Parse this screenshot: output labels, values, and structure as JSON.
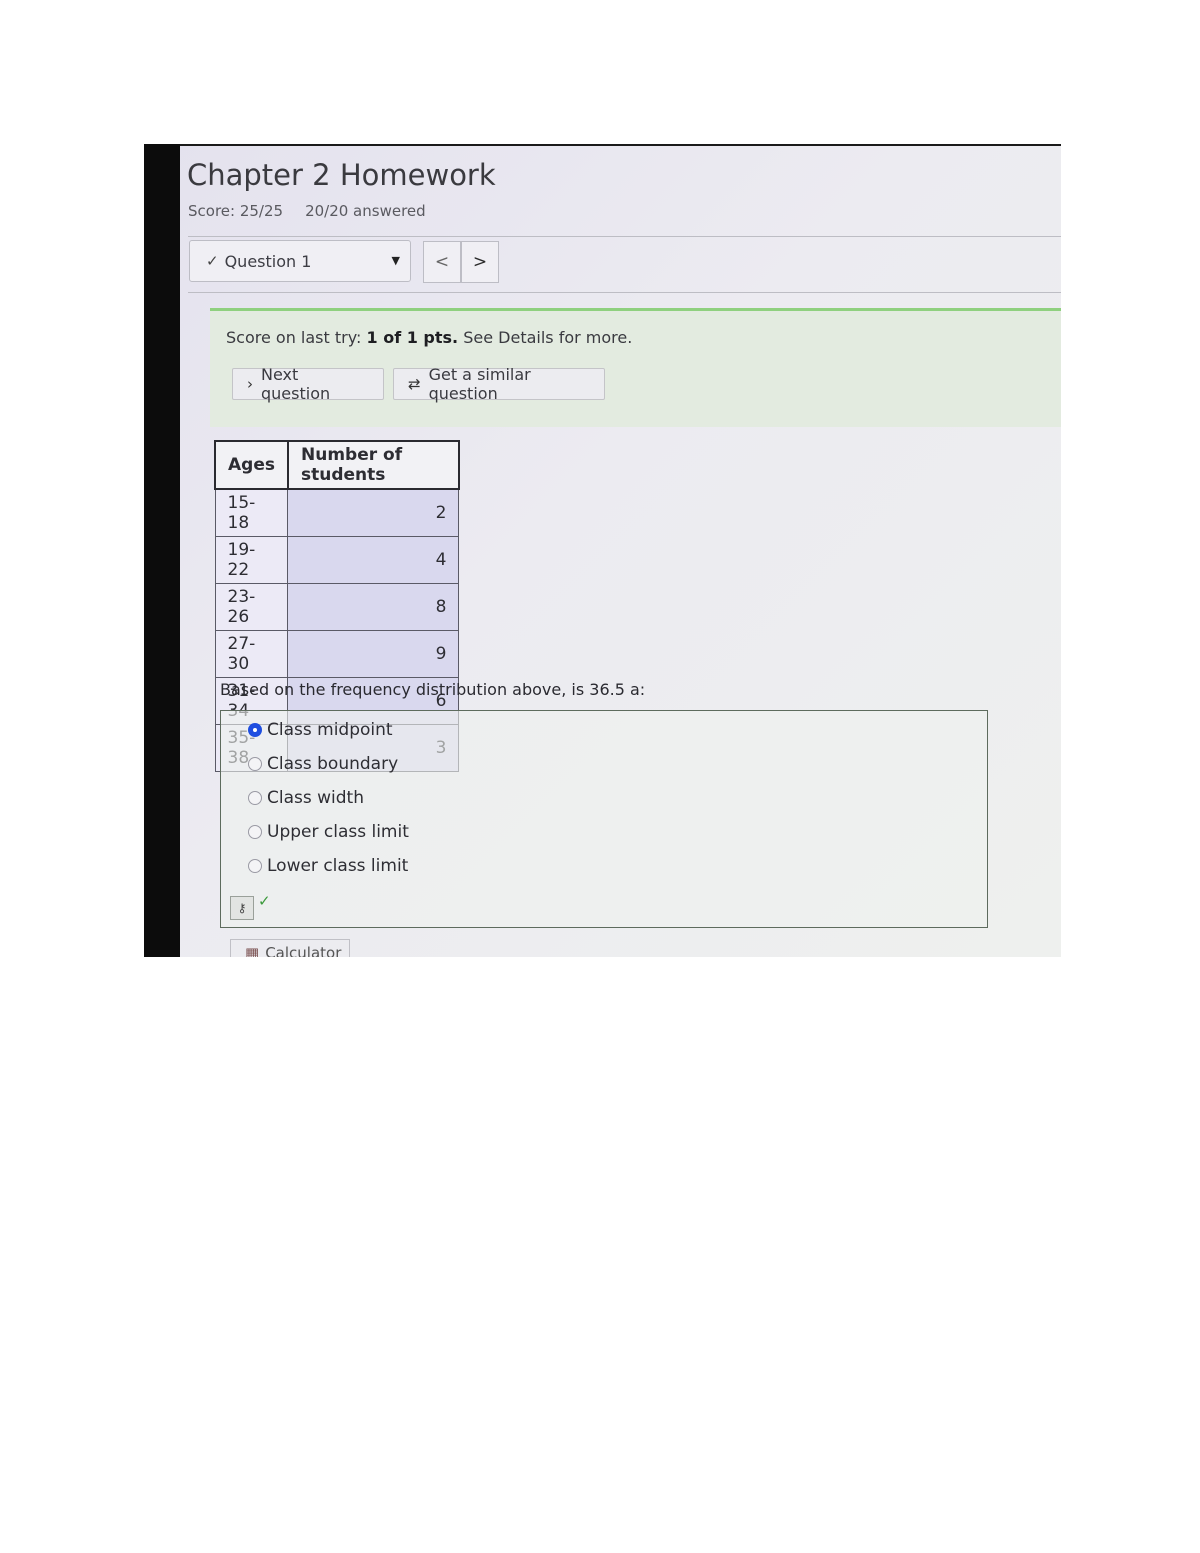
{
  "header": {
    "title": "Chapter 2 Homework",
    "score": "Score: 25/25",
    "answered": "20/20 answered"
  },
  "navigation": {
    "question_select": "Question 1",
    "prev_label": "<",
    "next_label": ">"
  },
  "feedback": {
    "prefix": "Score on last try: ",
    "points": "1 of 1 pts.",
    "suffix": " See Details for more.",
    "next_question_label": "Next question",
    "similar_question_label": "Get a similar question"
  },
  "frequency_table": {
    "headers": [
      "Ages",
      "Number of students"
    ],
    "rows": [
      {
        "ages": "15-18",
        "count": "2"
      },
      {
        "ages": "19-22",
        "count": "4"
      },
      {
        "ages": "23-26",
        "count": "8"
      },
      {
        "ages": "27-30",
        "count": "9"
      },
      {
        "ages": "31-34",
        "count": "6"
      },
      {
        "ages": "35-38",
        "count": "3"
      }
    ]
  },
  "question": {
    "text": "Based on the frequency distribution above, is 36.5 a:",
    "options": [
      {
        "label": "Class midpoint",
        "selected": true
      },
      {
        "label": "Class boundary",
        "selected": false
      },
      {
        "label": "Class width",
        "selected": false
      },
      {
        "label": "Upper class limit",
        "selected": false
      },
      {
        "label": "Lower class limit",
        "selected": false
      }
    ]
  },
  "tools": {
    "calculator_label": "Calculator"
  },
  "colors": {
    "correct_panel": "#e3ebe0",
    "correct_border": "#8fd07f",
    "radio_selected": "#1f4fe0",
    "table_cell": "#d9d8ee"
  },
  "icons": {
    "question_status": "checkmark-icon",
    "dropdown": "caret-down-icon",
    "next_question": "chevron-right-icon",
    "similar_question": "repeat-icon",
    "key": "key-icon",
    "correct": "checkmark-icon",
    "calculator": "calculator-icon"
  }
}
